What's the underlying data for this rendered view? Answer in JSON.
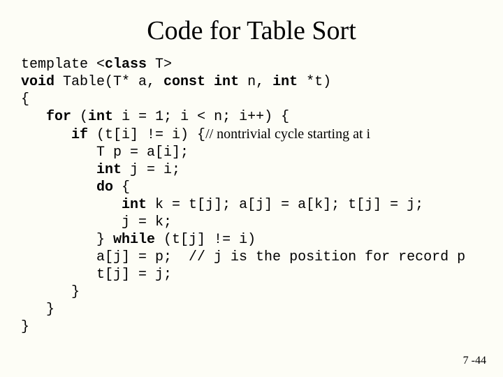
{
  "title": "Code for Table Sort",
  "page_number": "7 -44",
  "code": {
    "l01a": "template <",
    "l01b": "class",
    "l01c": " T>",
    "l02a": "void",
    "l02b": " Table(T* a, ",
    "l02c": "const int",
    "l02d": " n, ",
    "l02e": "int",
    "l02f": " *t)",
    "l03": "{",
    "l04a": "   ",
    "l04b": "for",
    "l04c": " (",
    "l04d": "int",
    "l04e": " i = 1; i < n; i++) {",
    "l05a": "      ",
    "l05b": "if",
    "l05c": " (t[i] != i) {",
    "l05d": "// nontrivial cycle starting at i",
    "l06": "         T p = a[i];",
    "l07a": "         ",
    "l07b": "int",
    "l07c": " j = i;",
    "l08a": "         ",
    "l08b": "do",
    "l08c": " {",
    "l09a": "            ",
    "l09b": "int",
    "l09c": " k = t[j]; a[j] = a[k]; t[j] = j;",
    "l10": "            j = k;",
    "l11a": "         } ",
    "l11b": "while",
    "l11c": " (t[j] != i)",
    "l12": "         a[j] = p;  // j is the position for record p",
    "l13": "         t[j] = j;",
    "l14": "      }",
    "l15": "   }",
    "l16": "}"
  }
}
